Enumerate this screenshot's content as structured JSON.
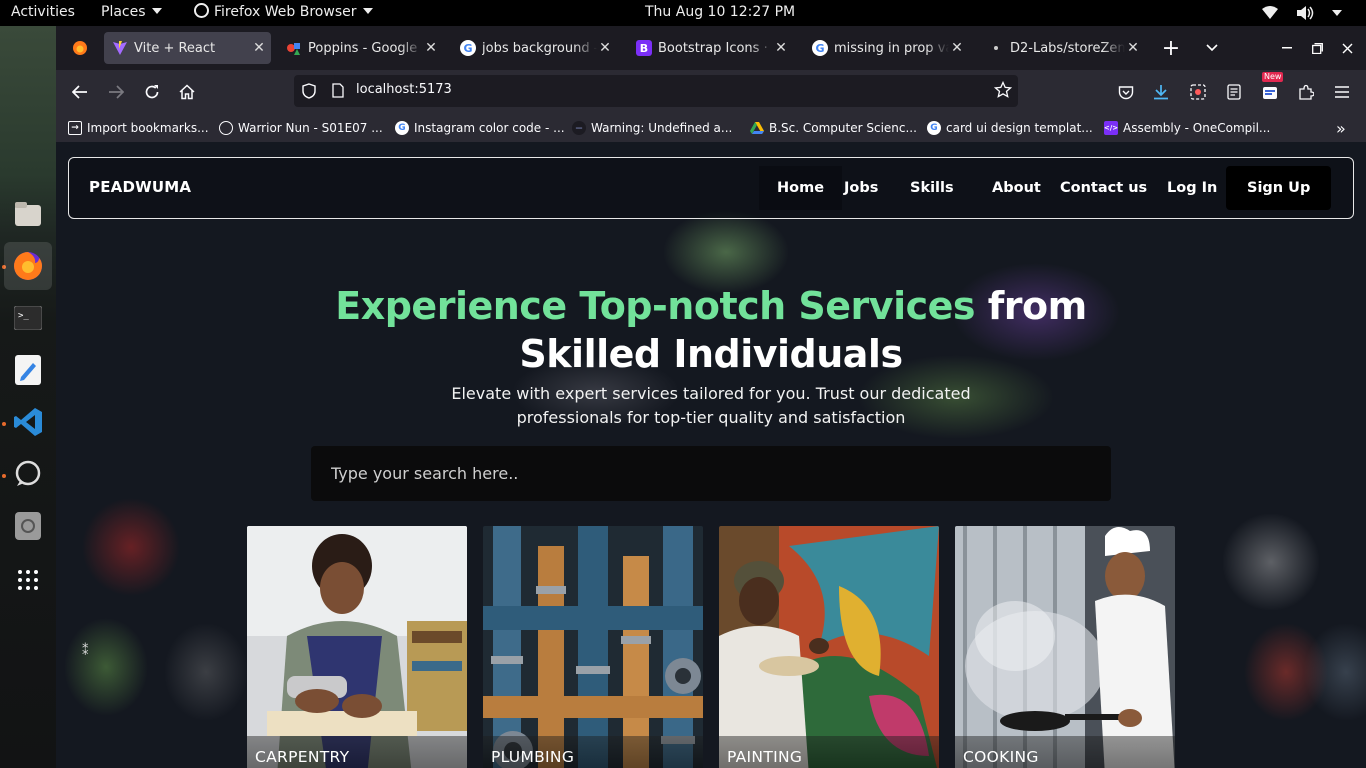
{
  "desktop": {
    "activities": "Activities",
    "places": "Places",
    "app_menu": "Firefox Web Browser",
    "clock": "Thu Aug 10  12:27 PM"
  },
  "browser": {
    "tabs": [
      {
        "label": "Vite + React",
        "active": true
      },
      {
        "label": "Poppins - Google Fonts"
      },
      {
        "label": "jobs background - Google Search"
      },
      {
        "label": "Bootstrap Icons · Official open source SVG icon library"
      },
      {
        "label": "missing in prop validation - Google Search"
      },
      {
        "label": "D2-Labs/storeZen"
      }
    ],
    "url": "localhost:5173",
    "extension_badge": "New",
    "bookmarks": [
      "Import bookmarks...",
      "Warrior Nun - S01E07 ...",
      "Instagram color code - ...",
      "Warning: Undefined a...",
      "B.Sc. Computer Scienc...",
      "card ui design templat...",
      "Assembly - OneCompil..."
    ]
  },
  "site": {
    "brand": "PEADWUMA",
    "nav": [
      "Home",
      "Jobs",
      "Skills",
      "About",
      "Contact us",
      "Log In",
      "Sign Up"
    ],
    "hero": {
      "title_highlight": "Experience Top-notch Services",
      "title_rest_1": " from",
      "title_rest_2": "Skilled Individuals",
      "subtitle": "Elevate with expert services tailored for you. Trust our dedicated professionals for top-tier quality and satisfaction"
    },
    "search": {
      "placeholder": "Type your search here.."
    },
    "cards": [
      "CARPENTRY",
      "PLUMBING",
      "PAINTING",
      "COOKING"
    ]
  },
  "colors": {
    "accent_green": "#72e29a",
    "page_bg": "#141820",
    "browser_tabstrip": "#1c1b22",
    "browser_toolbar": "#2b2a33"
  }
}
